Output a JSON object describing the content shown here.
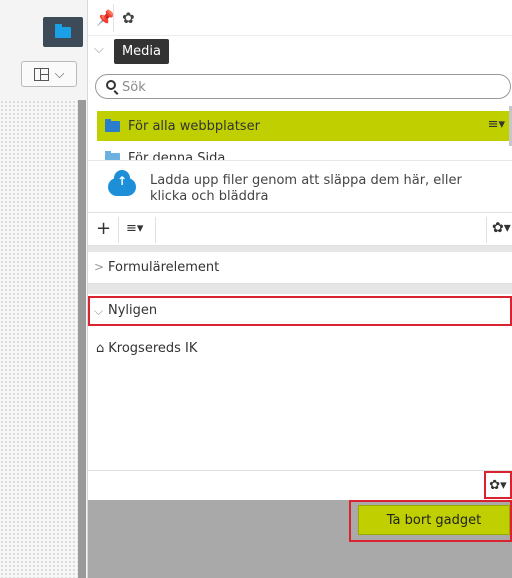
{
  "media_panel": {
    "tooltip": "Media",
    "search_placeholder": "Sök",
    "folders": [
      {
        "label": "För alla webbplatser"
      },
      {
        "label": "För denna Sida"
      }
    ],
    "upload_text": "Ladda upp filer genom att släppa dem här, eller klicka och bläddra",
    "toolbar": {
      "add": "+",
      "menu": "≡▾",
      "settings": "✿▾"
    }
  },
  "gadgets": {
    "form_elements": {
      "label": "Formulärelement"
    },
    "recent": {
      "label": "Nyligen",
      "items": [
        {
          "label": "Krogsereds IK"
        }
      ]
    }
  },
  "context_menu": {
    "remove_gadget": "Ta bort gadget"
  },
  "colors": {
    "accent": "#bfcf00",
    "highlight": "#d9232e",
    "rail_button": "#3d4a57"
  },
  "icons": {
    "media_tab": "folder-icon",
    "layout": "grid-layout-icon",
    "pin": "pin-icon",
    "settings": "gear-icon",
    "search": "search-icon",
    "upload": "cloud-upload-icon",
    "home": "home-icon"
  }
}
